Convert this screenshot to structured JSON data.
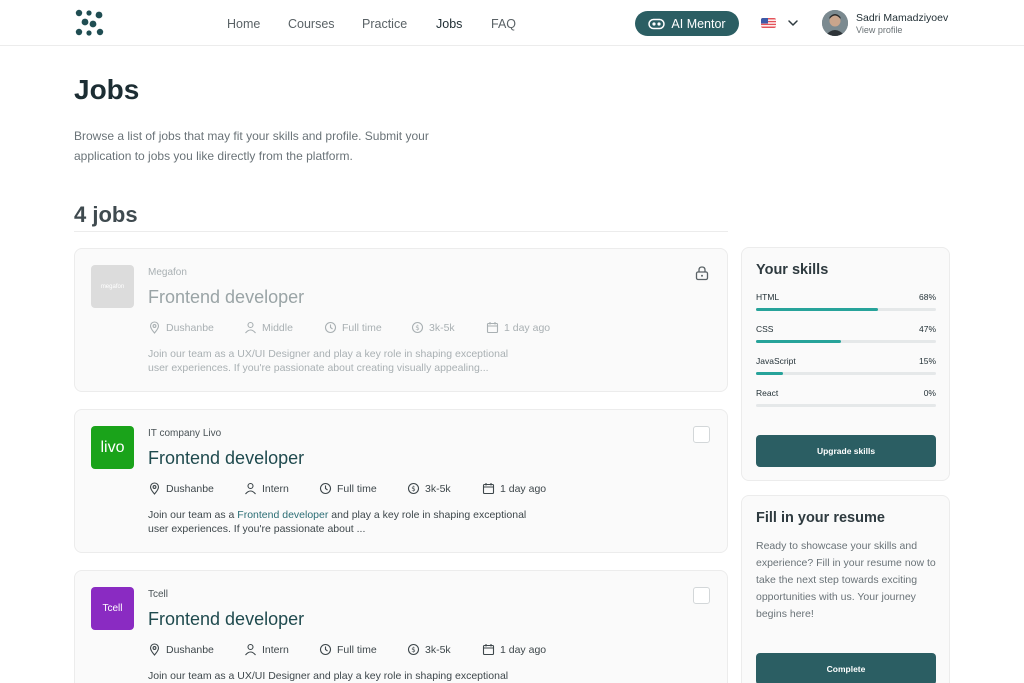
{
  "header": {
    "nav": [
      {
        "label": "Home"
      },
      {
        "label": "Courses"
      },
      {
        "label": "Practice"
      },
      {
        "label": "Jobs",
        "active": true
      },
      {
        "label": "FAQ"
      }
    ],
    "ai_button_label": "AI Mentor",
    "language_icon": "us-flag-icon",
    "user_name": "Sadri Mamadziyoev",
    "view_profile_label": "View profile"
  },
  "page": {
    "title": "Jobs",
    "intro": "Browse a list of jobs that may fit your skills and profile. Submit your application to jobs you like directly from the platform.",
    "jobs_count_label": "4 jobs"
  },
  "jobs": [
    {
      "company": "Megafon",
      "logo_text": "megafon",
      "title": "Frontend developer",
      "location": "Dushanbe",
      "level": "Middle",
      "type": "Full time",
      "salary": "3k-5k",
      "posted": "1 day ago",
      "desc_line1": "Join our team as a UX/UI Designer and play a key role in shaping exceptional",
      "desc_line2": "user experiences. If you're passionate about creating visually appealing...",
      "locked": true
    },
    {
      "company": "IT company Livo",
      "logo_text": "livo",
      "title": "Frontend developer",
      "location": "Dushanbe",
      "level": "Intern",
      "type": "Full time",
      "salary": "3k-5k",
      "posted": "1 day ago",
      "desc_pre": "Join our team as a ",
      "desc_highlight": "Frontend developer",
      "desc_post": " and play a key role in shaping exceptional",
      "desc_line2": "user experiences. If you're passionate about ...",
      "locked": false
    },
    {
      "company": "Tcell",
      "logo_text": "Tcell",
      "title": "Frontend developer",
      "location": "Dushanbe",
      "level": "Intern",
      "type": "Full time",
      "salary": "3k-5k",
      "posted": "1 day ago",
      "desc_line1": "Join our team as a UX/UI Designer and play a key role in shaping exceptional",
      "locked": false
    }
  ],
  "skills_panel": {
    "title": "Your skills",
    "skills": [
      {
        "name": "HTML",
        "value_label": "68%",
        "percent": 68
      },
      {
        "name": "CSS",
        "value_label": "47%",
        "percent": 47
      },
      {
        "name": "JavaScript",
        "value_label": "15%",
        "percent": 15
      },
      {
        "name": "React",
        "value_label": "0%",
        "percent": 0
      }
    ],
    "button_label": "Upgrade skills"
  },
  "resume_panel": {
    "title": "Fill in your resume",
    "text": "Ready to showcase your skills and experience? Fill in your resume now to take the next step towards exciting opportunities with us. Your journey begins here!",
    "button_label": "Complete"
  },
  "colors": {
    "accent": "#2b5e63",
    "progress": "#27a39a",
    "livo_green": "#1aa31a",
    "tcell_purple": "#8a2bc2"
  }
}
